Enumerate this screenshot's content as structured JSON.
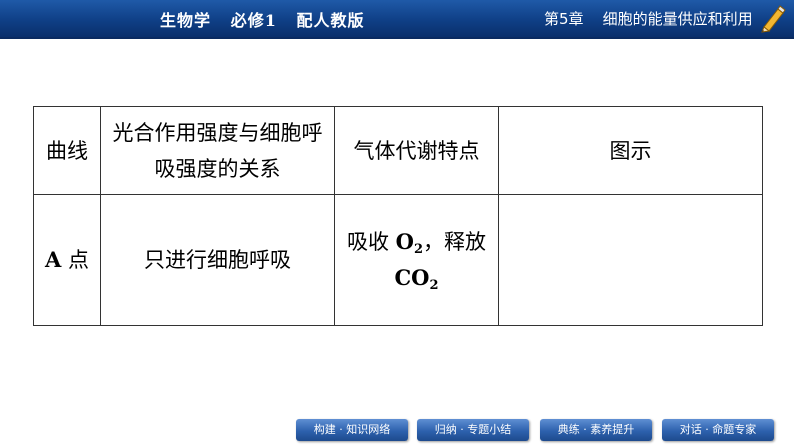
{
  "header": {
    "book_title": "生物学   必修1   配人教版",
    "chapter": "第5章    细胞的能量供应和利用",
    "pencil_icon": "pencil-icon"
  },
  "table": {
    "headers": [
      "曲线",
      "光合作用强度与细胞呼吸强度的关系",
      "气体代谢特点",
      "图示"
    ],
    "row": {
      "curve_letter": "A",
      "curve_suffix": " 点",
      "relation": "只进行细胞呼吸",
      "gas_text1": "吸收 ",
      "gas_o": "O",
      "gas_o_sub": "2",
      "gas_text2": "，释放",
      "gas_co": "CO",
      "gas_co_sub": "2",
      "figure": ""
    }
  },
  "nav": [
    {
      "label": "构建 · 知识网络"
    },
    {
      "label": "归纳 · 专题小结"
    },
    {
      "label": "典练 · 素养提升"
    },
    {
      "label": "对话 · 命题专家"
    }
  ],
  "colors": {
    "header_bg": "#0f3f86",
    "nav_bg": "#2d61ad",
    "pencil_body": "#f2b632"
  }
}
